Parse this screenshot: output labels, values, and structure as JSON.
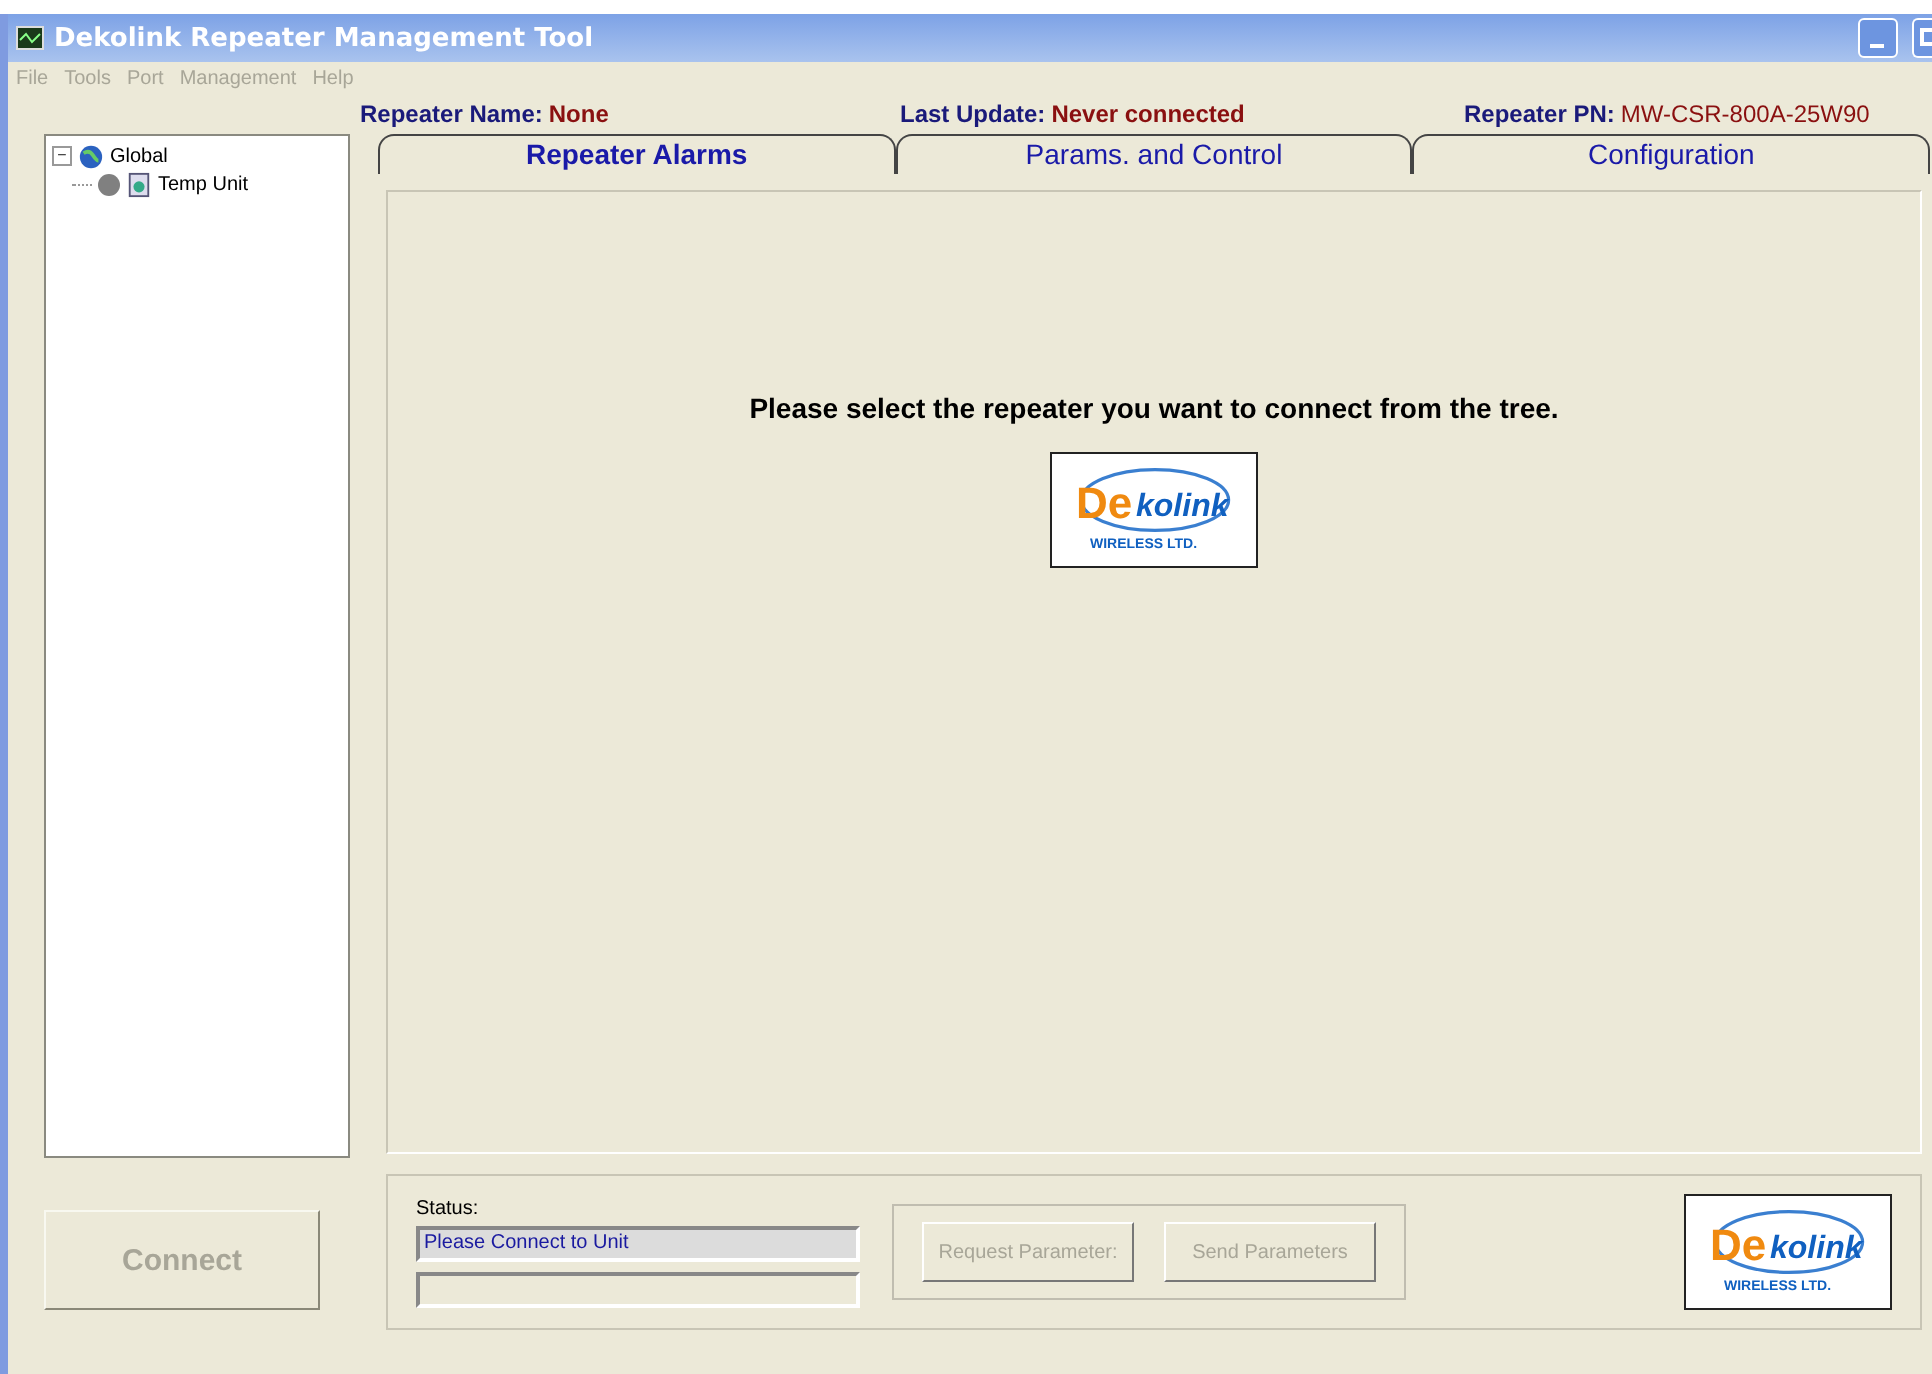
{
  "window": {
    "title": "Dekolink Repeater Management Tool"
  },
  "menu": [
    {
      "label": "File",
      "disabled": true
    },
    {
      "label": "Tools",
      "disabled": true
    },
    {
      "label": "Port",
      "disabled": true
    },
    {
      "label": "Management",
      "disabled": true
    },
    {
      "label": "Help",
      "disabled": true
    }
  ],
  "info": [
    {
      "label": "Repeater Name:",
      "value": "None",
      "kind": "bold"
    },
    {
      "label": "Last Update:",
      "value": "Never connected",
      "kind": "bold"
    },
    {
      "label": "Repeater PN:",
      "value": "MW-CSR-800A-25W90",
      "kind": "plain"
    }
  ],
  "tree": [
    {
      "label": "Global",
      "expanded": true,
      "expander": "−",
      "children": [
        {
          "label": "Temp Unit"
        }
      ]
    }
  ],
  "tabs": [
    {
      "label": "Repeater Alarms",
      "selected": true
    },
    {
      "label": "Params. and Control",
      "selected": false
    },
    {
      "label": "Configuration",
      "selected": false
    }
  ],
  "message": "Please select the repeater you want to connect from the tree.",
  "logos": [
    {
      "mark": "De",
      "name": "kolink",
      "tagline": "WIRELESS LTD."
    },
    {
      "mark": "De",
      "name": "kolink",
      "tagline": "WIRELESS LTD."
    }
  ],
  "connect": {
    "label": "Connect",
    "disabled": true
  },
  "status": {
    "label": "Status:",
    "value": "Please Connect to Unit"
  },
  "buttons": [
    {
      "label": "Request Parameter:",
      "disabled": true
    },
    {
      "label": "Send  Parameters",
      "disabled": true
    }
  ]
}
